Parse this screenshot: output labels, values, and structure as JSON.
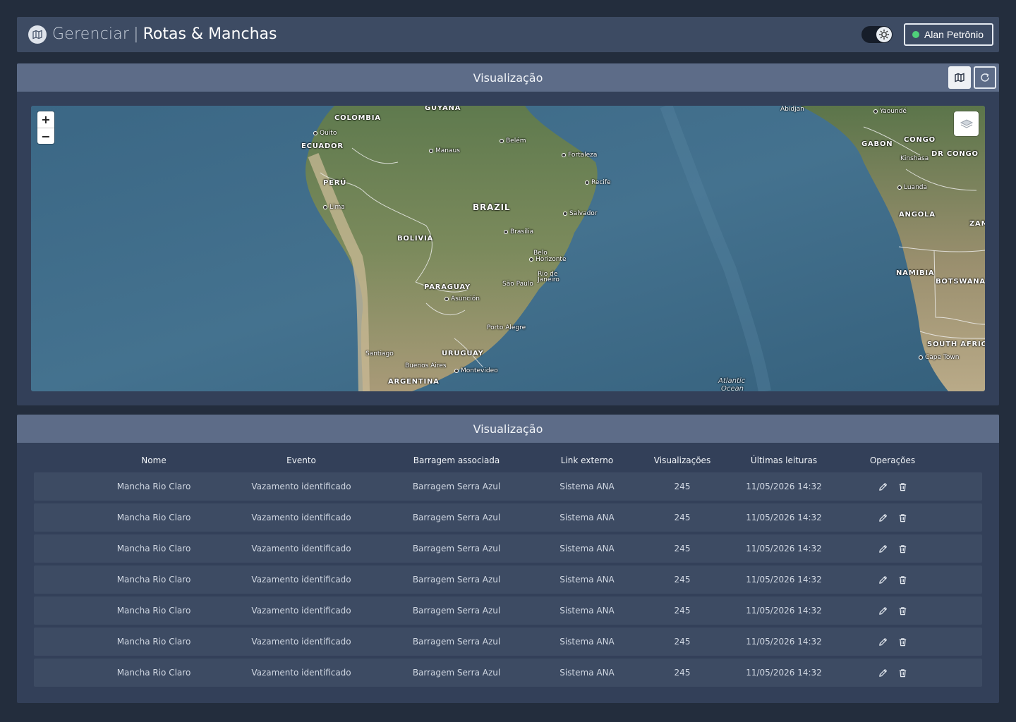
{
  "header": {
    "title_light": "Gerenciar",
    "separator": "|",
    "title_bold": "Rotas & Manchas",
    "user_name": "Alan Petrônio",
    "user_status_color": "#4fd17a"
  },
  "map_panel": {
    "title": "Visualização",
    "zoom_in": "+",
    "zoom_out": "−",
    "labels": {
      "guyana": "GUYANA",
      "colombia": "COLOMBIA",
      "quito": "Quito",
      "ecuador": "ECUADOR",
      "manaus": "Manaus",
      "belem": "Belém",
      "fortaleza": "Fortaleza",
      "peru": "PERÚ",
      "recife": "Recife",
      "lima": "Lima",
      "brazil": "BRAZIL",
      "salvador": "Salvador",
      "brasilia": "Brasília",
      "bolivia": "BOLIVIA",
      "belo_horizonte_1": "Belo",
      "belo_horizonte_2": "Horizonte",
      "rio_1": "Rio de",
      "rio_2": "Janeiro",
      "sao_paulo": "São Paulo",
      "paraguay": "PARAGUAY",
      "asuncion": "Asunción",
      "porto_alegre": "Porto Alegre",
      "santiago": "Santiago",
      "uruguay": "URUGUAY",
      "buenos_aires": "Buenos Aires",
      "montevideo": "Montevideo",
      "argentina": "ARGENTINA",
      "atlantic_1": "Atlantic",
      "atlantic_2": "Ocean",
      "abidjan": "Abidjan",
      "yaounde": "Yaoundé",
      "gabon": "GABON",
      "congo": "CONGO",
      "kinshasa": "Kinshasa",
      "dr_congo": "DR CONGO",
      "luanda": "Luanda",
      "angola": "ANGOLA",
      "zambia": "ZAM",
      "namibia": "NAMIBIA",
      "botswana": "BOTSWANA",
      "south_africa": "SOUTH AFRICA",
      "cape_town": "Cape Town"
    }
  },
  "table_panel": {
    "title": "Visualização",
    "columns": [
      "Nome",
      "Evento",
      "Barragem associada",
      "Link externo",
      "Visualizações",
      "Últimas leituras",
      "Operações"
    ],
    "rows": [
      [
        "Mancha Rio Claro",
        "Vazamento identificado",
        "Barragem Serra Azul",
        "Sistema ANA",
        "245",
        "11/05/2026 14:32"
      ],
      [
        "Mancha Rio Claro",
        "Vazamento identificado",
        "Barragem Serra Azul",
        "Sistema ANA",
        "245",
        "11/05/2026 14:32"
      ],
      [
        "Mancha Rio Claro",
        "Vazamento identificado",
        "Barragem Serra Azul",
        "Sistema ANA",
        "245",
        "11/05/2026 14:32"
      ],
      [
        "Mancha Rio Claro",
        "Vazamento identificado",
        "Barragem Serra Azul",
        "Sistema ANA",
        "245",
        "11/05/2026 14:32"
      ],
      [
        "Mancha Rio Claro",
        "Vazamento identificado",
        "Barragem Serra Azul",
        "Sistema ANA",
        "245",
        "11/05/2026 14:32"
      ],
      [
        "Mancha Rio Claro",
        "Vazamento identificado",
        "Barragem Serra Azul",
        "Sistema ANA",
        "245",
        "11/05/2026 14:32"
      ],
      [
        "Mancha Rio Claro",
        "Vazamento identificado",
        "Barragem Serra Azul",
        "Sistema ANA",
        "245",
        "11/05/2026 14:32"
      ]
    ]
  },
  "icons": {
    "logo": "map-logo-icon",
    "theme": "sun-icon",
    "map_view": "map-icon",
    "refresh": "refresh-icon",
    "layers": "layers-icon",
    "edit": "pencil-icon",
    "delete": "trash-icon"
  }
}
